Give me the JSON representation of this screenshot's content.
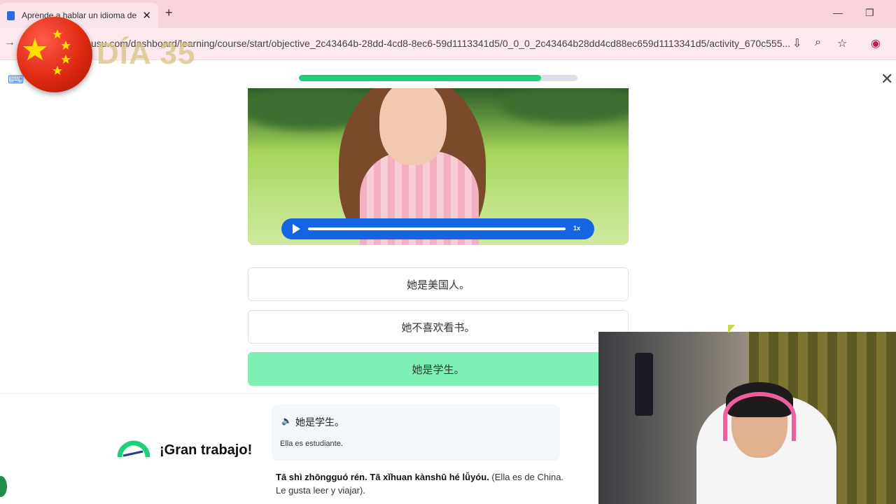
{
  "browser": {
    "tab_title": "Aprende a hablar un idioma de",
    "tab_close": "✕",
    "new_tab": "+",
    "url": "usu.com/dashboard/learning/course/start/objective_2c43464b-28dd-4cd8-8ec6-59d1113341d5/0_0_0_2c43464b28dd4cd88ec659d1113341d5/activity_670c555...",
    "minimize": "—",
    "restore": "❐"
  },
  "overlay": {
    "day_label": "DÍA 35"
  },
  "lesson": {
    "progress_fraction": 0.87,
    "audio_speed": "1x",
    "options": [
      {
        "text": "她是美国人。",
        "selected": false
      },
      {
        "text": "她不喜欢看书。",
        "selected": false
      },
      {
        "text": "她是学生。",
        "selected": true
      }
    ]
  },
  "feedback": {
    "title": "¡Gran trabajo!",
    "answer_zh": "她是学生。",
    "answer_es": "Ella es estudiante.",
    "explanation_pinyin": "Tā shì zhōngguó rén. Tā xǐhuan kànshū hé lǚyóu.",
    "explanation_es": " (Ella es de China. Le gusta leer y viajar)."
  },
  "colors": {
    "progress_fill": "#1fcf79",
    "audio_bar": "#1565e3",
    "selected_option": "#7ef0b6",
    "tab_bar": "#f7d3da"
  },
  "icons": [
    "favicon-icon",
    "close-icon",
    "plus-icon",
    "back-arrow-icon",
    "install-icon",
    "zoom-icon",
    "star-icon",
    "profile-icon",
    "keyboard-icon",
    "play-icon",
    "speaker-icon",
    "gauge-icon",
    "china-flag-icon"
  ]
}
